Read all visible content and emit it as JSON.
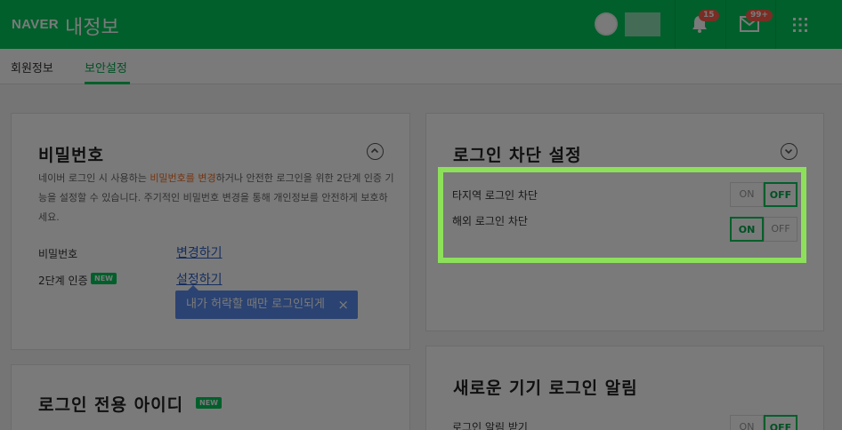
{
  "header": {
    "logo": "NAVER",
    "title": "내정보",
    "notifications_badge": "15",
    "mail_badge": "99+"
  },
  "subnav": {
    "tabs": [
      {
        "label": "회원정보"
      },
      {
        "label": "보안설정"
      }
    ]
  },
  "password_card": {
    "title": "비밀번호",
    "desc_part1": "네이버 로그인 시 사용하는 ",
    "desc_accent": "비밀번호를 변경",
    "desc_part2": "하거나 안전한 로그인을 위한 2단계 인증 기능을 설정할 수 있습니다. 주기적인 비밀번호 변경을 통해 개인정보를 안전하게 보호하세요.",
    "rows": [
      {
        "label": "비밀번호",
        "action": "변경하기"
      },
      {
        "label": "2단계 인증",
        "badge": "NEW",
        "action": "설정하기"
      }
    ],
    "tooltip": "내가 허락할 때만 로그인되게",
    "tooltip_close": "×"
  },
  "login_only_card": {
    "title": "로그인 전용 아이디",
    "badge": "NEW"
  },
  "block_card": {
    "title": "로그인 차단 설정",
    "rows": [
      {
        "label": "타지역 로그인 차단",
        "on": "ON",
        "off": "OFF",
        "state": "OFF"
      },
      {
        "label": "해외 로그인 차단",
        "on": "ON",
        "off": "OFF",
        "state": "ON"
      }
    ]
  },
  "new_device_card": {
    "title": "새로운 기기 로그인 알림",
    "rows": [
      {
        "label": "로그인 알림 받기",
        "on": "ON",
        "off": "OFF",
        "state": "OFF"
      }
    ]
  },
  "colors": {
    "brand": "#03c75a",
    "highlight": "#8de05a",
    "link": "#2e60c7",
    "accent": "#f66e22"
  }
}
